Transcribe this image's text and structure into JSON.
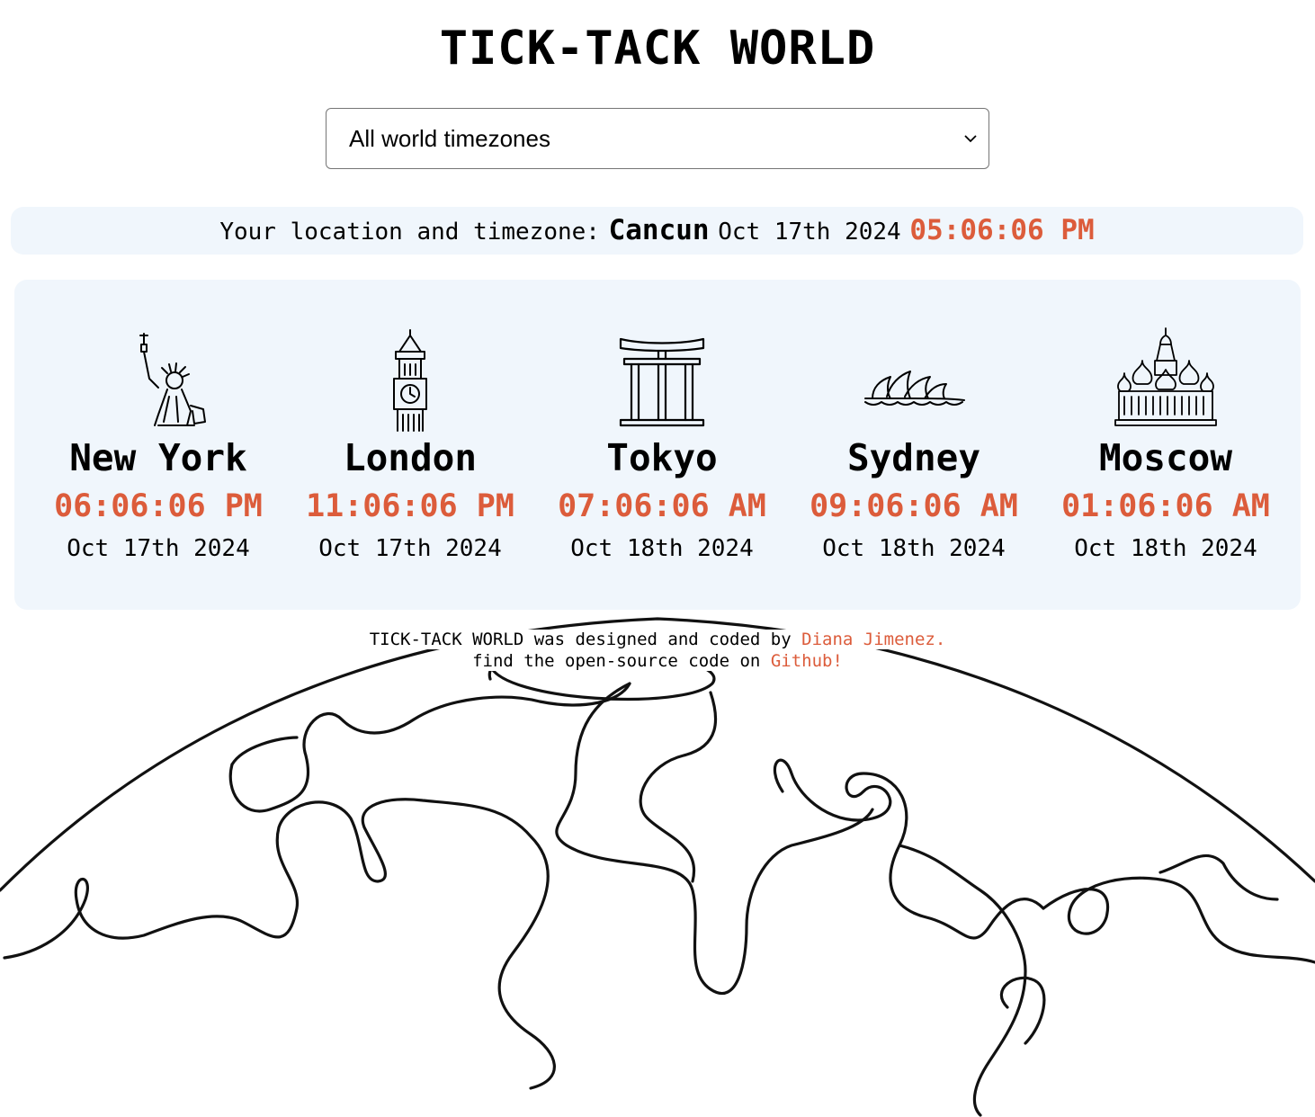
{
  "header": {
    "title": "TICK-TACK WORLD"
  },
  "timezone_select": {
    "selected": "All world timezones"
  },
  "location": {
    "label": "Your location and timezone:",
    "city": "Cancun",
    "date": "Oct 17th 2024",
    "time": "05:06:06 PM"
  },
  "cities": [
    {
      "name": "New York",
      "time": "06:06:06 PM",
      "date": "Oct 17th 2024",
      "icon": "statue-of-liberty-icon"
    },
    {
      "name": "London",
      "time": "11:06:06 PM",
      "date": "Oct 17th 2024",
      "icon": "big-ben-icon"
    },
    {
      "name": "Tokyo",
      "time": "07:06:06 AM",
      "date": "Oct 18th 2024",
      "icon": "torii-gate-icon"
    },
    {
      "name": "Sydney",
      "time": "09:06:06 AM",
      "date": "Oct 18th 2024",
      "icon": "sydney-opera-house-icon"
    },
    {
      "name": "Moscow",
      "time": "01:06:06 AM",
      "date": "Oct 18th 2024",
      "icon": "st-basils-cathedral-icon"
    }
  ],
  "footer": {
    "line1_prefix": "TICK-TACK WORLD was designed and coded by",
    "author": "Diana Jimenez.",
    "line2_prefix": "find the open-source code on",
    "repo_link": "Github!"
  },
  "colors": {
    "accent": "#dc5c3b",
    "panel_bg": "#f0f6fc",
    "text": "#000000",
    "page_bg": "#ffffff"
  }
}
